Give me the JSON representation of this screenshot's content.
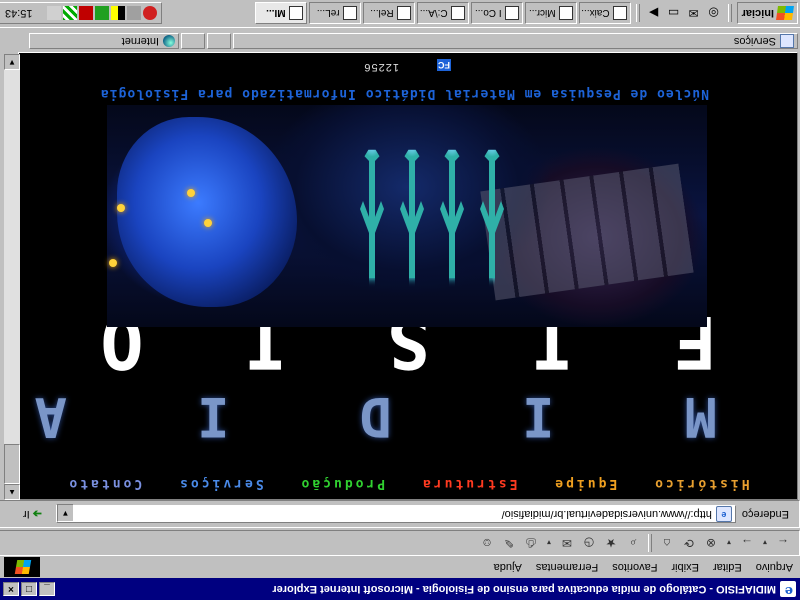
{
  "window": {
    "title": "MIDIAFISIO - Catálogo de mídia educativa para ensino de Fisiologia - Microsoft Internet Explorer",
    "controls": {
      "minimize": "_",
      "maximize": "□",
      "close": "×"
    }
  },
  "menu": [
    "Arquivo",
    "Editar",
    "Exibir",
    "Favoritos",
    "Ferramentas",
    "Ajuda"
  ],
  "toolbar": {
    "icons": [
      "back-icon",
      "forward-icon",
      "stop-icon",
      "refresh-icon",
      "home-icon",
      "search-icon",
      "favorites-icon",
      "history-icon",
      "mail-icon",
      "print-icon",
      "edit-icon",
      "messenger-icon"
    ]
  },
  "address": {
    "label": "Endereço",
    "url": "http://www.universidadevirtual.br/midiafisio/",
    "go": "Ir"
  },
  "content": {
    "nav": [
      {
        "label": "Histórico",
        "color": "#e8a030"
      },
      {
        "label": "Equipe",
        "color": "#f0a020"
      },
      {
        "label": "Estrutura",
        "color": "#ff3a20"
      },
      {
        "label": "Produção",
        "color": "#30d030"
      },
      {
        "label": "Serviços",
        "color": "#4a8ae8"
      },
      {
        "label": "Contato",
        "color": "#7a90e0"
      }
    ],
    "brand_top": "MIDIA",
    "brand_main": "FISIO",
    "subtitle": "Núcleo de Pesquisa em Material Didático Informatizado para Fisiologia",
    "badge": "FC",
    "counter": "12256"
  },
  "status": {
    "text": "Serviços",
    "zone": "Internet"
  },
  "taskbar": {
    "start": "Iniciar",
    "quicklaunch": [
      "ie-icon",
      "outlook-icon",
      "desktop-icon",
      "media-icon"
    ],
    "tasks": [
      "Caix...",
      "Micr...",
      "I Co...",
      "C:\\A...",
      "Rel...",
      "reL...",
      "MI..."
    ],
    "clock": "15:43"
  }
}
